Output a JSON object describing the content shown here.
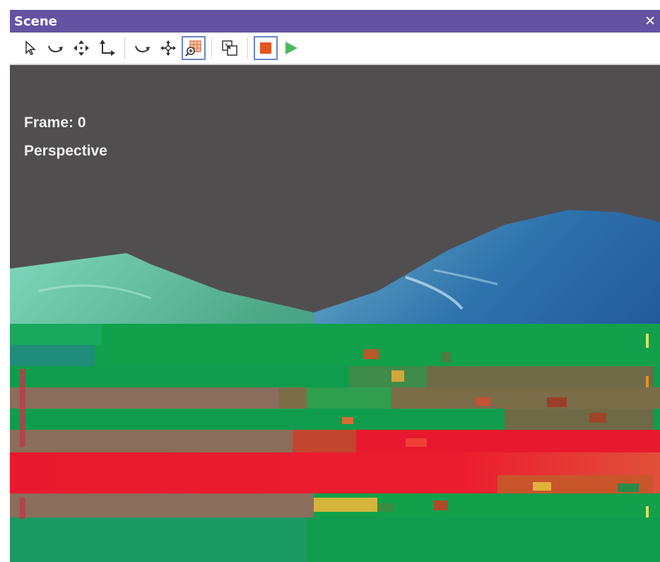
{
  "window": {
    "title": "Scene",
    "close_glyph": "✕"
  },
  "toolbar": {
    "tools": [
      {
        "name": "select-tool",
        "icon": "arrow-pointer-icon",
        "active": false
      },
      {
        "name": "rotate-tool",
        "icon": "rotate-icon",
        "active": false
      },
      {
        "name": "move-tool",
        "icon": "move-arrows-icon",
        "active": false
      },
      {
        "name": "scale-tool",
        "icon": "axes-icon",
        "active": false
      },
      {
        "name": "orbit-tool",
        "icon": "orbit-icon",
        "active": false
      },
      {
        "name": "pan-tool",
        "icon": "pan-icon",
        "active": false
      },
      {
        "name": "zoom-grid-tool",
        "icon": "zoom-grid-icon",
        "active": true
      },
      {
        "name": "frame-tool",
        "icon": "frame-icon",
        "active": false
      },
      {
        "name": "stop-button",
        "icon": "stop-icon",
        "active": true
      },
      {
        "name": "play-button",
        "icon": "play-icon",
        "active": false
      }
    ]
  },
  "viewport": {
    "frame_label": "Frame: 0",
    "view_label": "Perspective",
    "background": "#514e4f"
  },
  "colors": {
    "titlebar": "#6453a3",
    "left_wave": "#57b99b",
    "right_wave": "#2a5fa3",
    "glitch_green": "#12a04a",
    "glitch_red": "#e8192e",
    "glitch_brown": "#7b6d48"
  }
}
